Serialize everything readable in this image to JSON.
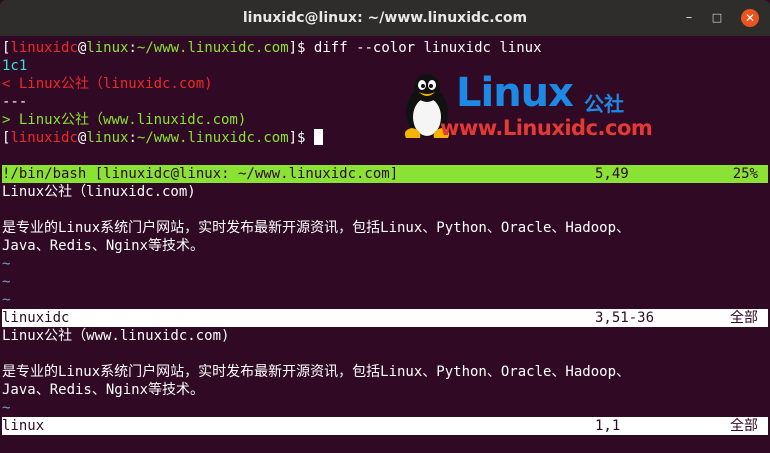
{
  "window": {
    "title": "linuxidc@linux: ~/www.linuxidc.com"
  },
  "controls": {
    "minimize": "–",
    "maximize": "□",
    "close": "✕"
  },
  "prompt": {
    "user": "linuxidc",
    "at": "@",
    "host": "linux",
    "colon": ":",
    "path": "~/www.linuxidc.com",
    "open": "[",
    "close": "]$ "
  },
  "command": "diff --color linuxidc linux",
  "diff": {
    "hunk": "1c1",
    "removed": "< Linux公社（linuxidc.com)",
    "sep": "---",
    "added": "> Linux公社（www.linuxidc.com)"
  },
  "logo": {
    "word": "Linux",
    "cn": "公社",
    "url": "www.Linuxidc.com"
  },
  "vim": {
    "status_top": {
      "left": "!/bin/bash [linuxidc@linux: ~/www.linuxidc.com]",
      "pos": "5,49",
      "pct": "25%"
    },
    "pane1": {
      "line1": "Linux公社（linuxidc.com)",
      "line3": "是专业的Linux系统门户网站，实时发布最新开源资讯，包括Linux、Python、Oracle、Hadoop、",
      "line4": "Java、Redis、Nginx等技术。",
      "tilde": "~"
    },
    "status_mid": {
      "left": "linuxidc",
      "pos": "3,51-36",
      "pct": "全部"
    },
    "pane2": {
      "line1": "Linux公社（www.linuxidc.com)",
      "line3": "是专业的Linux系统门户网站，实时发布最新开源资讯，包括Linux、Python、Oracle、Hadoop、",
      "line4": "Java、Redis、Nginx等技术。",
      "tilde": "~"
    },
    "status_bot": {
      "left": "linux",
      "pos": "1,1",
      "pct": "全部"
    }
  },
  "colors": {
    "background": "#300a24",
    "status_green": "#8ae234",
    "user_red": "#ef2929",
    "host_green": "#8ae234"
  }
}
